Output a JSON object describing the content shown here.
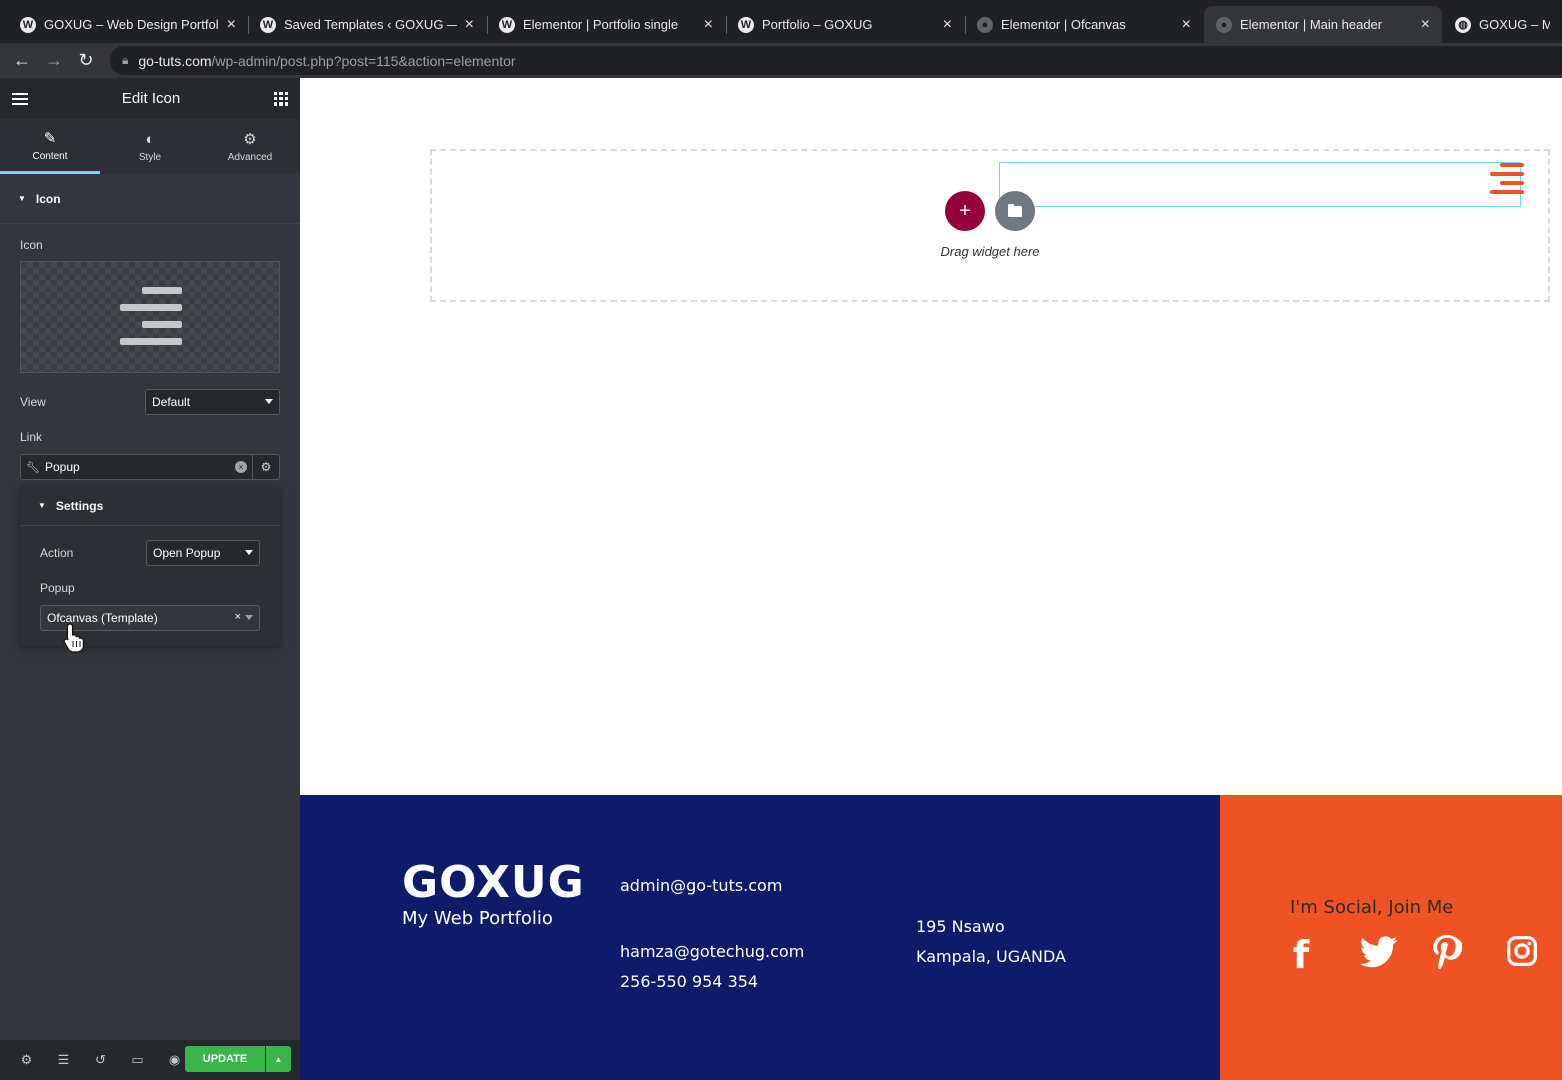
{
  "browser": {
    "tabs": [
      {
        "label": "GOXUG – Web Design Portfolio",
        "icon": "wordpress-icon"
      },
      {
        "label": "Saved Templates ‹ GOXUG — V",
        "icon": "wordpress-icon"
      },
      {
        "label": "Elementor | Portfolio single",
        "icon": "wordpress-icon"
      },
      {
        "label": "Portfolio – GOXUG",
        "icon": "wordpress-icon"
      },
      {
        "label": "Elementor | Ofcanvas",
        "icon": "globe-icon"
      },
      {
        "label": "Elementor | Main header",
        "icon": "globe-icon"
      },
      {
        "label": "GOXUG – My W",
        "icon": "globe-icon"
      }
    ],
    "active_tab": 5,
    "url_host": "go-tuts.com",
    "url_path": "/wp-admin/post.php?post=115&action=elementor"
  },
  "panel": {
    "title": "Edit Icon",
    "tabs": [
      {
        "label": "Content",
        "icon": "pencil-icon"
      },
      {
        "label": "Style",
        "icon": "contrast-icon"
      },
      {
        "label": "Advanced",
        "icon": "gear-icon"
      }
    ],
    "section_title": "Icon",
    "icon_label": "Icon",
    "view_label": "View",
    "view_value": "Default",
    "link_label": "Link",
    "link_value": "Popup",
    "settings_title": "Settings",
    "action_label": "Action",
    "action_value": "Open Popup",
    "popup_label": "Popup",
    "popup_value": "Ofcanvas (Template)",
    "update_label": "UPDATE"
  },
  "canvas": {
    "drag_text": "Drag widget here",
    "accent_color": "#f05323",
    "add_color": "#93003c"
  },
  "site_footer": {
    "brand": "GOXUG",
    "tagline": "My Web Portfolio",
    "email1": "admin@go-tuts.com",
    "email2": "hamza@gotechug.com",
    "phone": "256-550 954 354",
    "address1": "195 Nsawo",
    "address2": "Kampala, UGANDA",
    "social_title": "I'm Social, Join Me",
    "social_icons": [
      "facebook-icon",
      "twitter-icon",
      "pinterest-icon",
      "instagram-icon"
    ],
    "blue": "#0e1b6a",
    "orange": "#f05323"
  }
}
